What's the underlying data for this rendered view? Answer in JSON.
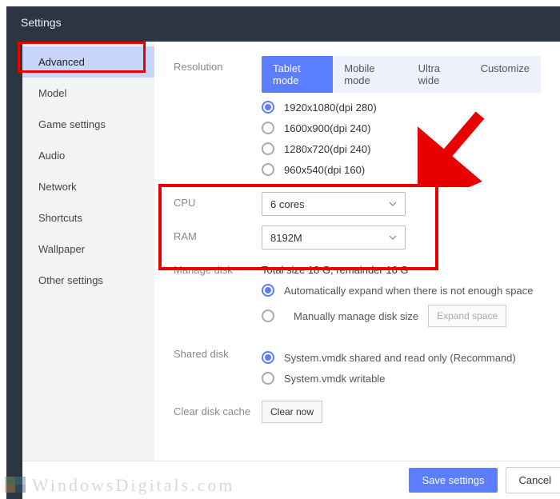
{
  "window": {
    "title": "Settings"
  },
  "sidebar": {
    "items": [
      {
        "label": "Advanced",
        "active": true
      },
      {
        "label": "Model"
      },
      {
        "label": "Game settings"
      },
      {
        "label": "Audio"
      },
      {
        "label": "Network"
      },
      {
        "label": "Shortcuts"
      },
      {
        "label": "Wallpaper"
      },
      {
        "label": "Other settings"
      }
    ]
  },
  "labels": {
    "resolution": "Resolution",
    "cpu": "CPU",
    "ram": "RAM",
    "manage_disk": "Manage disk",
    "shared_disk": "Shared disk",
    "clear_cache": "Clear disk cache"
  },
  "resolution": {
    "tabs": [
      {
        "label": "Tablet mode",
        "active": true
      },
      {
        "label": "Mobile mode"
      },
      {
        "label": "Ultra wide"
      },
      {
        "label": "Customize"
      }
    ],
    "options": [
      {
        "label": "1920x1080(dpi 280)",
        "selected": true
      },
      {
        "label": "1600x900(dpi 240)"
      },
      {
        "label": "1280x720(dpi 240)"
      },
      {
        "label": "960x540(dpi 160)"
      }
    ]
  },
  "cpu": {
    "value": "6 cores"
  },
  "ram": {
    "value": "8192M"
  },
  "manage_disk": {
    "summary": "Total size 18 G, remainder 16 G",
    "opts": [
      {
        "label": "Automatically expand when there is not enough space",
        "selected": true
      },
      {
        "label": "Manually manage disk size"
      }
    ],
    "expand_btn": "Expand space"
  },
  "shared_disk": {
    "opts": [
      {
        "label": "System.vmdk shared and read only (Recommand)",
        "selected": true
      },
      {
        "label": "System.vmdk writable"
      }
    ]
  },
  "clear_cache": {
    "btn": "Clear now"
  },
  "footer": {
    "save": "Save settings",
    "cancel": "Cancel"
  },
  "watermark": "WindowsDigitals.com",
  "annotation": {
    "arrow_color": "#e60000"
  }
}
